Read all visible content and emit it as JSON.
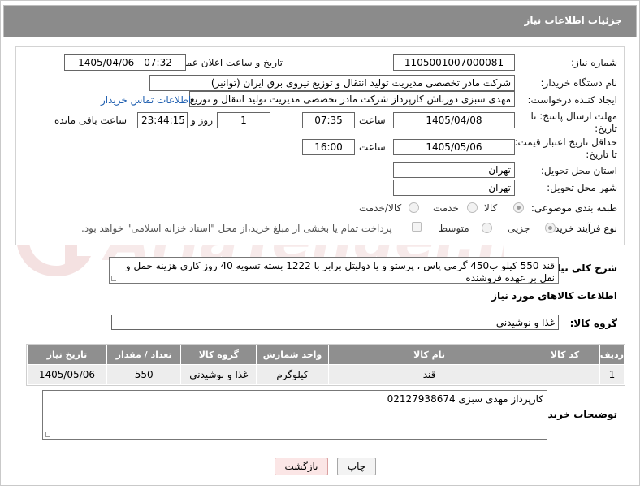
{
  "header": {
    "title": "جزئیات اطلاعات نیاز"
  },
  "form": {
    "need_number_label": "شماره نیاز:",
    "need_number": "1105001007000081",
    "announce_label": "تاریخ و ساعت اعلان عمومی:",
    "announce_value": "1405/04/06 - 07:32",
    "buyer_org_label": "نام دستگاه خریدار:",
    "buyer_org": "شرکت مادر تخصصی مدیریت تولید  انتقال و توزیع نیروی برق ایران (توانیر)",
    "requester_label": "ایجاد کننده درخواست:",
    "requester": "مهدی سبزی دورباش کارپرداز شرکت مادر تخصصی مدیریت تولید  انتقال و توزیع نیروی برق ایران (توانیر)",
    "contact_link": "اطلاعات تماس خریدار",
    "deadline_label_1": "مهلت ارسال پاسخ: تا",
    "deadline_label_2": "تاریخ:",
    "deadline_date": "1405/04/08",
    "time_label": "ساعت",
    "deadline_time": "07:35",
    "days": "1",
    "days_label": "روز و",
    "remaining_time": "23:44:15",
    "remaining_label": "ساعت باقی مانده",
    "price_label_1": "حداقل تاریخ اعتبار قیمت:",
    "price_label_2": "تا تاریخ:",
    "price_date": "1405/05/06",
    "price_time": "16:00",
    "province_label": "استان محل تحویل:",
    "province": "تهران",
    "city_label": "شهر محل تحویل:",
    "city": "تهران",
    "category_label": "طبقه بندی موضوعی:",
    "category_options": [
      "کالا",
      "خدمت",
      "کالا/خدمت"
    ],
    "process_label": "نوع فرآیند خرید :",
    "process_options": [
      "جزیی",
      "متوسط"
    ],
    "payment_note": "پرداخت تمام یا بخشی از مبلغ خرید،از محل \"اسناد خزانه اسلامی\" خواهد بود."
  },
  "description": {
    "label": "شرح کلی نیاز:",
    "text": "قند 550 کیلو ب450 گرمی پاس ، پرستو و یا دولیتل برابر با 1222 بسته تسویه 40 روز کاری هزینه حمل و نقل بر عهده فروشنده"
  },
  "goods_info": {
    "title": "اطلاعات کالاهای مورد نیاز",
    "group_label": "گروه کالا:",
    "group_value": "غذا و نوشیدنی"
  },
  "table": {
    "headers": [
      "ردیف",
      "کد کالا",
      "نام کالا",
      "واحد شمارش",
      "گروه کالا",
      "تعداد / مقدار",
      "تاریخ نیاز"
    ],
    "rows": [
      [
        "1",
        "--",
        "قند",
        "کیلوگرم",
        "غذا و نوشیدنی",
        "550",
        "1405/05/06"
      ]
    ]
  },
  "buyer_notes": {
    "label": "توضیحات خریدار:",
    "text": "کارپرداز مهدی سبزی 02127938674"
  },
  "buttons": {
    "print": "چاپ",
    "back": "بازگشت"
  },
  "watermark": {
    "text": "AriaTender.neT"
  },
  "colors": {
    "header_bg": "#8b8b8b",
    "link": "#1f5fb0",
    "back_btn": "#fbe6e6"
  }
}
